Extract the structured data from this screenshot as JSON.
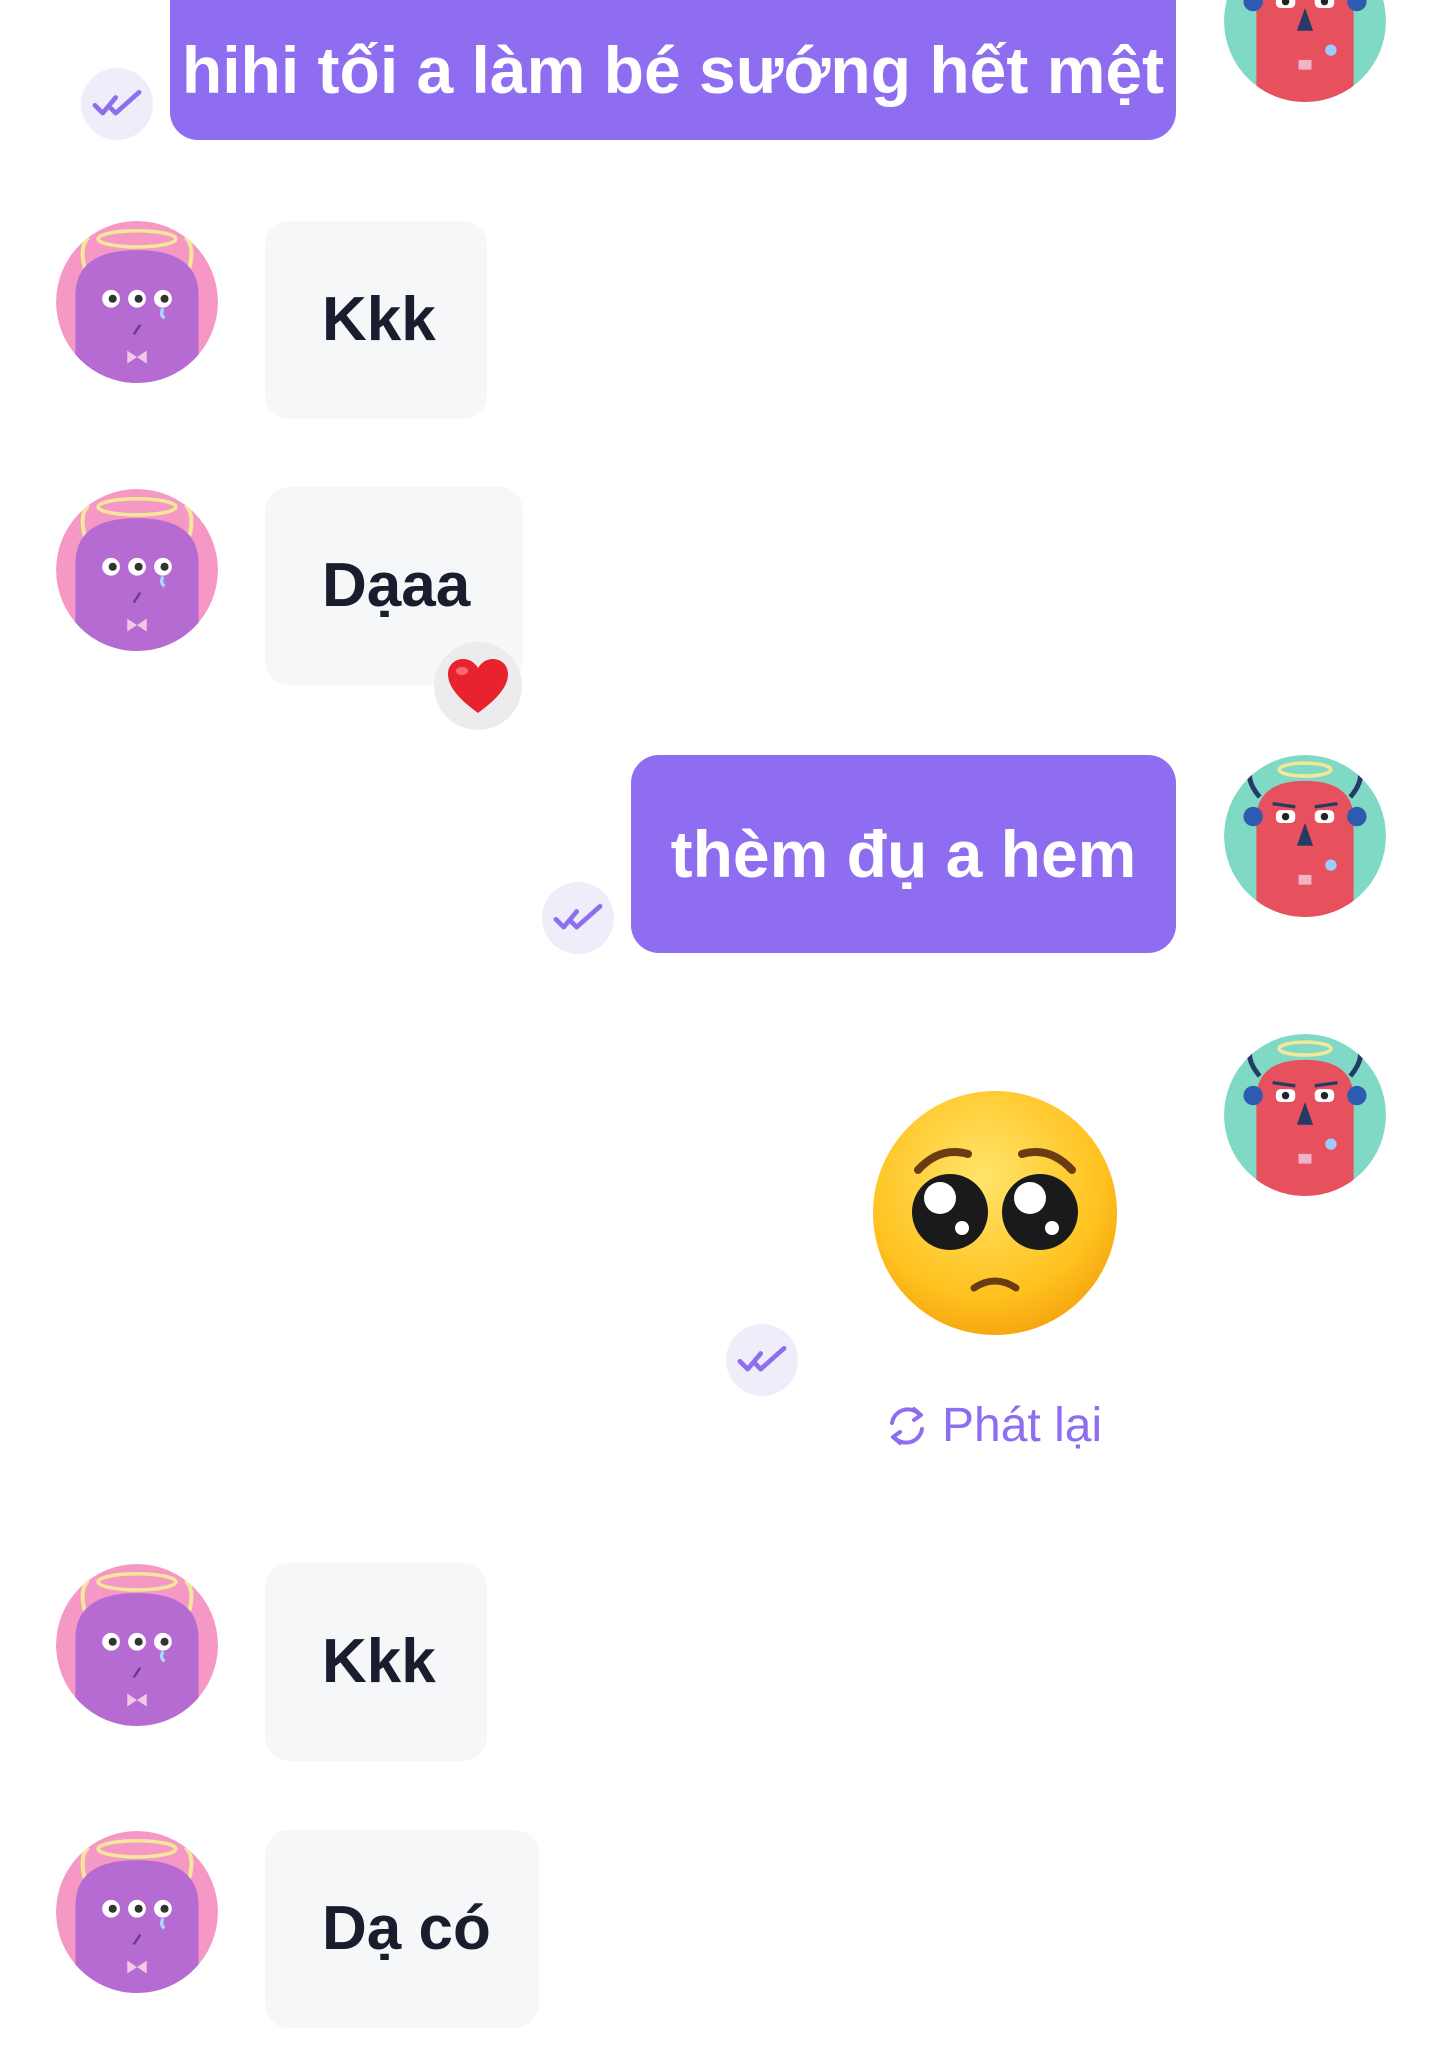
{
  "theme": {
    "accent": "#8e6df0",
    "incoming_bg": "#f6f7f9",
    "incoming_text": "#1a1d2e",
    "outgoing_text": "#ffffff"
  },
  "messages": [
    {
      "direction": "outgoing",
      "type": "text",
      "text": "hihi tối a làm bé sướng hết mệt",
      "status_icon": "double-check-icon"
    },
    {
      "direction": "incoming",
      "type": "text",
      "text": "Kkk"
    },
    {
      "direction": "incoming",
      "type": "text",
      "text": "Dạaa",
      "reaction": "❤️"
    },
    {
      "direction": "outgoing",
      "type": "text",
      "text": "thèm đụ a hem",
      "status_icon": "double-check-icon"
    },
    {
      "direction": "outgoing",
      "type": "animated-emoji",
      "emoji": "🥺",
      "status_icon": "double-check-icon",
      "replay_label": "Phát lại"
    },
    {
      "direction": "incoming",
      "type": "text",
      "text": "Kkk"
    },
    {
      "direction": "incoming",
      "type": "text",
      "text": "Dạ có"
    }
  ]
}
